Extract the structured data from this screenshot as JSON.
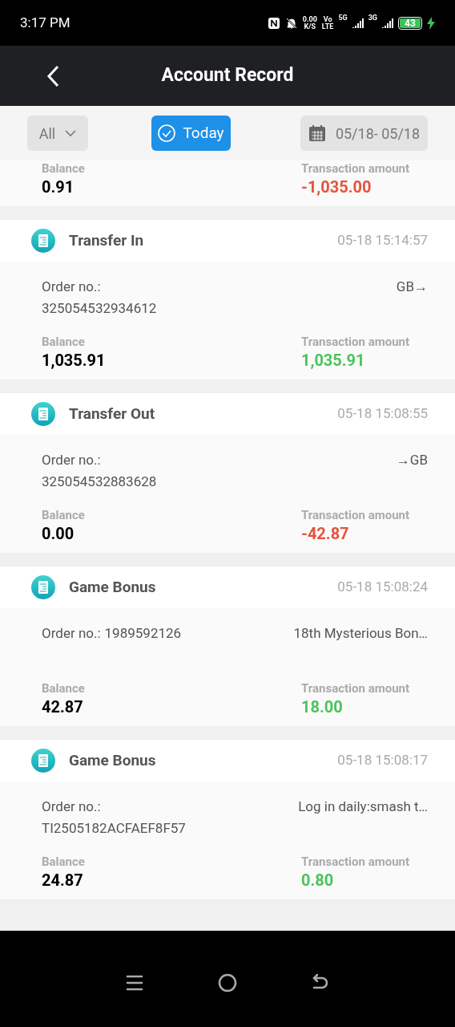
{
  "status_bar": {
    "time": "3:17 PM",
    "speed": "0.00",
    "speed_unit": "K/S",
    "volte_top": "Vo",
    "volte_bottom": "LTE",
    "net1": "5G",
    "net2": "3G",
    "battery": "43",
    "charging": true
  },
  "header": {
    "title": "Account Record"
  },
  "filters": {
    "type": "All",
    "today": {
      "label": "Today",
      "selected": true
    },
    "date_range": "05/18- 05/18"
  },
  "records": [
    {
      "balance_label": "Balance",
      "balance": "0.91",
      "amount_label": "Transaction amount",
      "amount": "-1,035.00",
      "color": "#e5533d"
    },
    {
      "title": "Transfer In",
      "time": "05-18 15:14:57",
      "order_label": "Order no.:",
      "order_no": "325054532934612",
      "stacked": true,
      "note": "GB→",
      "balance_label": "Balance",
      "balance": "1,035.91",
      "amount_label": "Transaction amount",
      "amount": "1,035.91",
      "color": "#4cc35c"
    },
    {
      "title": "Transfer Out",
      "time": "05-18 15:08:55",
      "order_label": "Order no.:",
      "order_no": "325054532883628",
      "stacked": true,
      "note": "→GB",
      "balance_label": "Balance",
      "balance": "0.00",
      "amount_label": "Transaction amount",
      "amount": "-42.87",
      "color": "#e5533d"
    },
    {
      "title": "Game Bonus",
      "time": "05-18 15:08:24",
      "order_label": "Order no.:",
      "order_no": "1989592126",
      "stacked": false,
      "note": "18th Mysterious Bon…",
      "balance_label": "Balance",
      "balance": "42.87",
      "amount_label": "Transaction amount",
      "amount": "18.00",
      "color": "#4cc35c"
    },
    {
      "title": "Game Bonus",
      "time": "05-18 15:08:17",
      "order_label": "Order no.:",
      "order_no": "TI2505182ACFAEF8F57",
      "stacked": true,
      "note": "Log in daily:smash t…",
      "balance_label": "Balance",
      "balance": "24.87",
      "amount_label": "Transaction amount",
      "amount": "0.80",
      "color": "#4cc35c"
    }
  ]
}
